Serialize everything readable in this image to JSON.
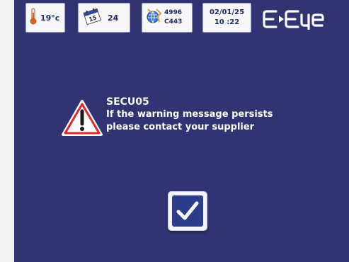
{
  "status_bar": {
    "temperature": "19°c",
    "calendar_day": "24",
    "network_id": "4996",
    "network_code": "C443",
    "date": "02/01/25",
    "time": "10 :22",
    "logo_text": "E-Eye"
  },
  "icons": {
    "temperature": "thermometer-icon",
    "calendar": "calendar-icon",
    "network": "network-icon",
    "warning": "warning-triangle-icon",
    "confirm": "checkmark-icon"
  },
  "warning": {
    "code": "SECU05",
    "line1": "If the warning message persists",
    "line2": "please contact your supplier"
  },
  "colors": {
    "panel_bg": "#313372",
    "tile_bg": "#f7f7f9",
    "warning_red": "#e0282c",
    "button_blue": "#2a3c8a"
  }
}
